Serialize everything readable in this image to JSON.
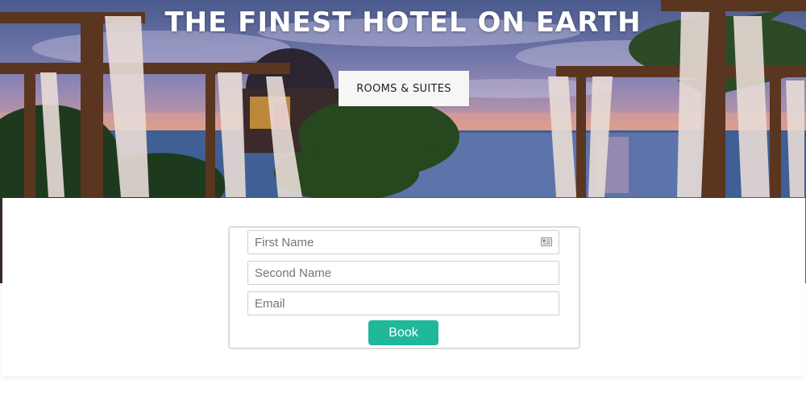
{
  "hero": {
    "title": "THE FINEST HOTEL ON EARTH",
    "rooms_button_label": "ROOMS & SUITES"
  },
  "booking_form": {
    "first_name_placeholder": "First Name",
    "second_name_placeholder": "Second Name",
    "email_placeholder": "Email",
    "book_label": "Book",
    "autofill_icon": "contact-card-icon"
  },
  "colors": {
    "book_button": "#1fb89b",
    "rooms_button_bg": "#f6f6f6",
    "title_text": "#ffffff"
  }
}
